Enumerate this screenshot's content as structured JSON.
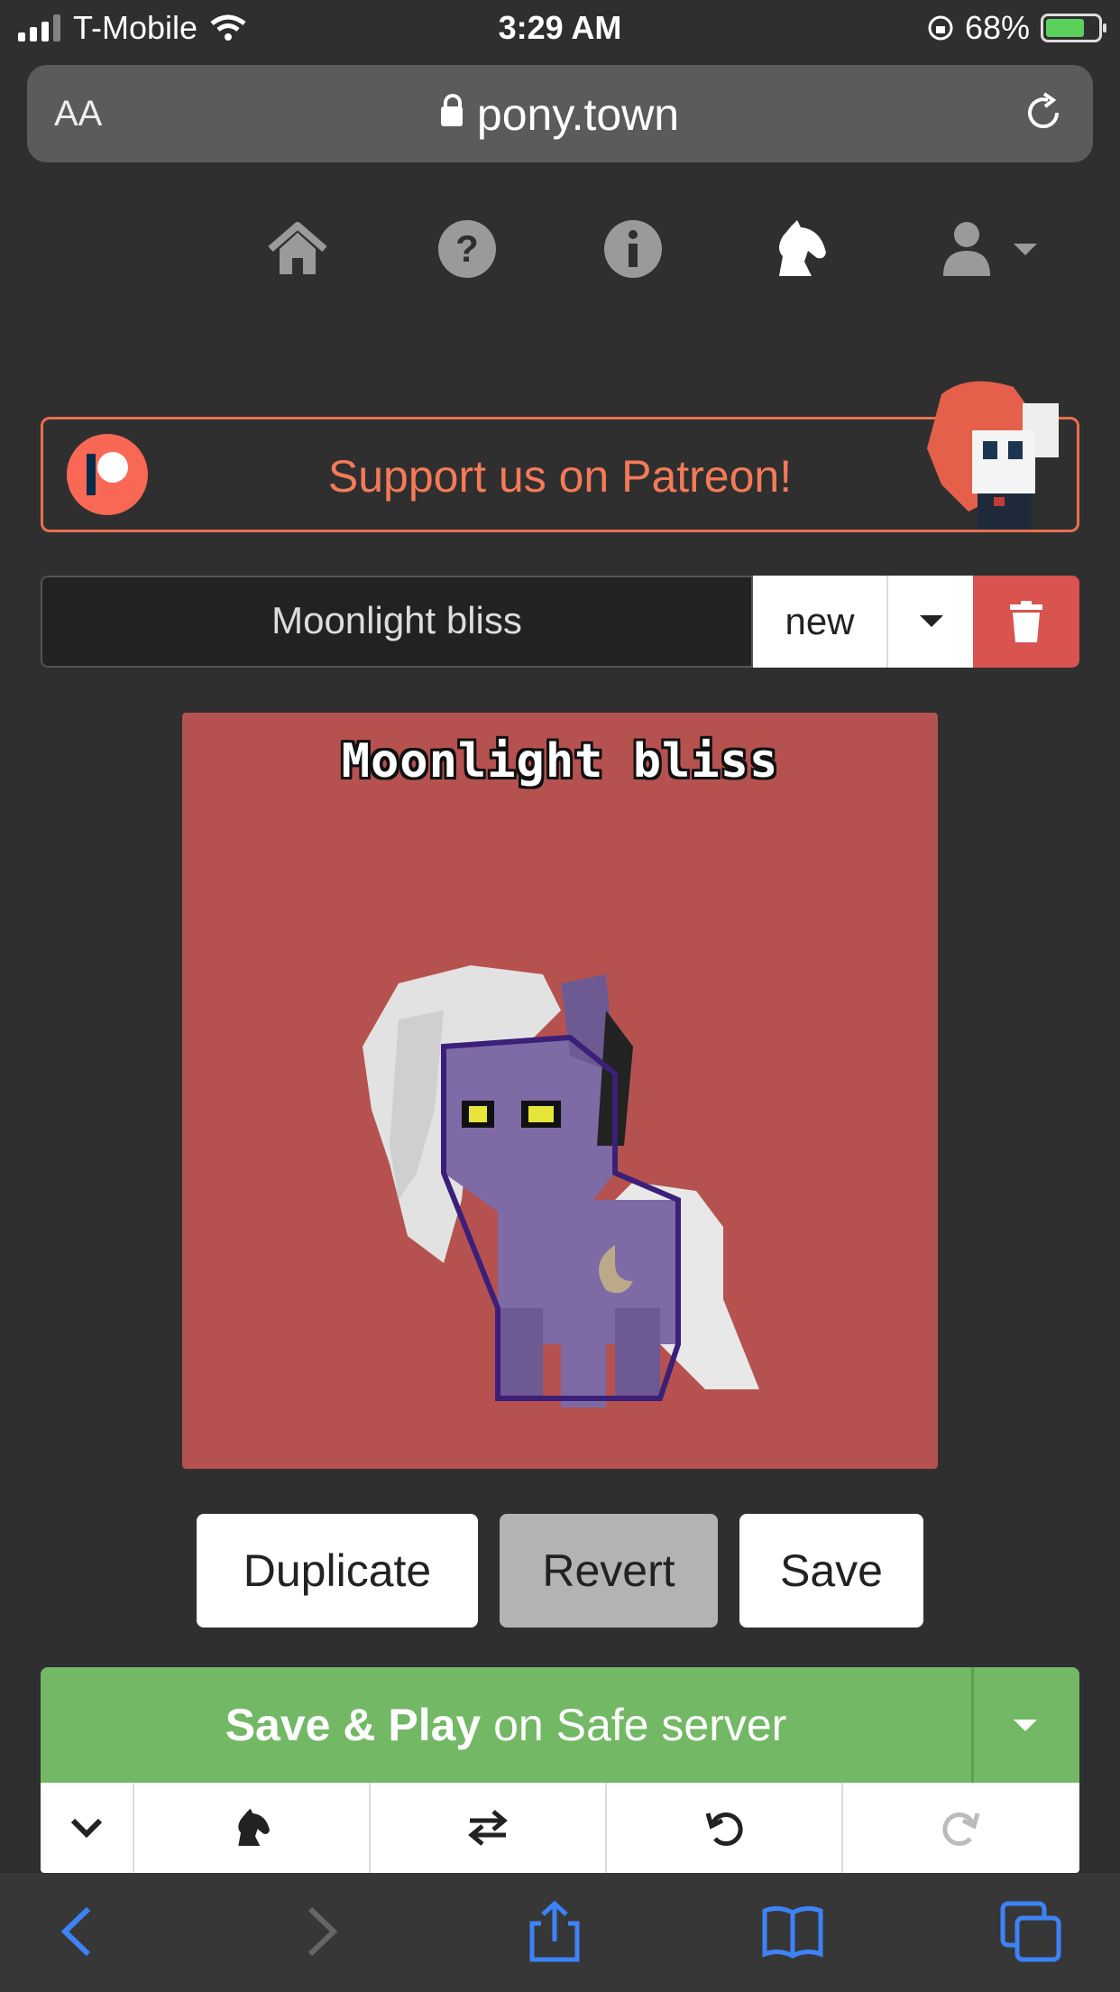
{
  "status": {
    "carrier": "T-Mobile",
    "time": "3:29 AM",
    "battery": "68%"
  },
  "browser": {
    "text_size_label": "AA",
    "url": "pony.town"
  },
  "nav": {
    "icons": [
      "home-icon",
      "help-icon",
      "info-icon",
      "horse-icon",
      "user-icon"
    ]
  },
  "banner": {
    "text": "Support us on Patreon!"
  },
  "character": {
    "name_value": "Moonlight bliss",
    "new_label": "new",
    "preview_name": "Moonlight bliss"
  },
  "actions": {
    "duplicate": "Duplicate",
    "revert": "Revert",
    "save": "Save"
  },
  "play": {
    "bold": "Save & Play",
    "rest": " on Safe server"
  },
  "toolbar": {
    "icons": [
      "collapse-icon",
      "horse-icon",
      "swap-icon",
      "undo-icon",
      "redo-icon"
    ]
  },
  "colors": {
    "background": "#2f2f2f",
    "accent_patreon": "#f47a58",
    "preview_bg": "#b5524f",
    "play_green": "#72b865",
    "delete_red": "#d9534f"
  }
}
